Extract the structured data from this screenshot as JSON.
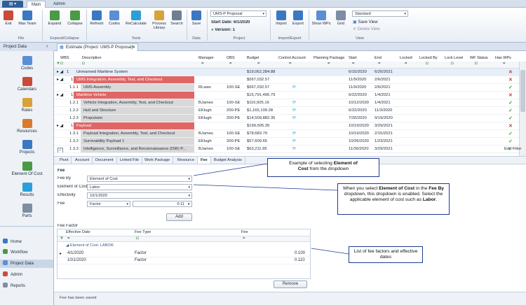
{
  "app_menu_label": "▤ ▾",
  "tabs": [
    {
      "label": "Main"
    },
    {
      "label": "Admin"
    }
  ],
  "ribbon": {
    "exit": "Exit",
    "max_team": "Max Team",
    "expand": "Expand",
    "collapse": "Collapse",
    "refresh": "Refresh",
    "codes": "Codes",
    "recalculate": "ReCalculate",
    "process_library_1": "Process",
    "process_library_2": "Library",
    "search": "Search",
    "save": "Save",
    "project_name": "UMS-P Proposal",
    "start_date_label": "Start Date:",
    "start_date_value": "6/1/2020",
    "version_label": "Version:",
    "version_value": "1",
    "import": "Import",
    "export": "Export",
    "show_wps": "Show WPs",
    "grid": "Grid",
    "view_name": "Standard",
    "save_view": "Save View",
    "delete_view": "Delete View",
    "groups": {
      "file": "File",
      "expand_collapse": "Expand/Collapse",
      "tools": "Tools",
      "data": "Data",
      "project": "Project",
      "import_export": "Import/Export",
      "view": "View"
    }
  },
  "left_panel": {
    "title": "Project Data",
    "items": [
      {
        "label": "Codes"
      },
      {
        "label": "Calendars"
      },
      {
        "label": "Rates"
      },
      {
        "label": "Resources"
      },
      {
        "label": "Projects"
      },
      {
        "label": "Element Of Cost"
      },
      {
        "label": "Results"
      },
      {
        "label": "Parts"
      }
    ],
    "bottom": [
      {
        "label": "Home"
      },
      {
        "label": "Workflow"
      },
      {
        "label": "Project Data"
      },
      {
        "label": "Admin"
      },
      {
        "label": "Reports"
      }
    ]
  },
  "doc_tab": "Estimate (Project: UMS-P Proposal)",
  "grid": {
    "headers": [
      "WBS",
      "Description",
      "Manager",
      "OBS",
      "Budget",
      "Control Account",
      "Planning Package",
      "Start",
      "End",
      "Locked",
      "Locked By",
      "Lock Level",
      "WF Status",
      "Has WPs"
    ],
    "rows": [
      {
        "wbs": "1",
        "desc": "Unmanned Maritime System",
        "mgr": "",
        "obs": "",
        "budget": "$19,062,284.88",
        "ca": "",
        "start": "6/15/2020",
        "end": "6/20/2021",
        "haswp": "✕",
        "style": "top"
      },
      {
        "wbs": "1.1",
        "desc": "UMS Integration, Assembly, Test, and Checkout",
        "mgr": "",
        "obs": "",
        "budget": "$567,032.57",
        "ca": "",
        "start": "11/9/2020",
        "end": "2/6/2021",
        "haswp": "✕",
        "style": "red"
      },
      {
        "wbs": "1.1.1",
        "desc": "UMS Assembly",
        "mgr": "RLaws",
        "obs": "100-SE",
        "budget": "$567,032.57",
        "ca": "⟳",
        "start": "11/9/2020",
        "end": "2/6/2021",
        "haswp": "✓",
        "style": "grey"
      },
      {
        "wbs": "1.2",
        "desc": "Maritime Vehicle",
        "mgr": "",
        "obs": "",
        "budget": "$15,791,496.79",
        "ca": "",
        "start": "6/22/2020",
        "end": "1/4/2021",
        "haswp": "✕",
        "style": "red"
      },
      {
        "wbs": "1.2.1",
        "desc": "Vehicle Integration, Assembly, Test, and Checkout",
        "mgr": "BJames",
        "obs": "100-SE",
        "budget": "$116,505.16",
        "ca": "⟳",
        "start": "10/12/2020",
        "end": "1/4/2021",
        "haswp": "✓",
        "style": "grey"
      },
      {
        "wbs": "1.2.2",
        "desc": "Hull and Structure",
        "mgr": "EKlugh",
        "obs": "200-PE",
        "budget": "$1,165,109.28",
        "ca": "⟳",
        "start": "6/22/2020",
        "end": "11/3/2020",
        "haswp": "✓",
        "style": "grey"
      },
      {
        "wbs": "1.2.3",
        "desc": "Propulsion",
        "mgr": "EKlugh",
        "obs": "200-PE",
        "budget": "$14,509,882.35",
        "ca": "⟳",
        "start": "7/20/2020",
        "end": "9/19/2020",
        "haswp": "✓",
        "style": "grey"
      },
      {
        "wbs": "1.3",
        "desc": "Payload",
        "mgr": "",
        "obs": "",
        "budget": "$199,505.39",
        "ca": "",
        "start": "10/19/2020",
        "end": "3/29/2021",
        "haswp": "✕",
        "style": "red"
      },
      {
        "wbs": "1.3.1",
        "desc": "Payload Integration, Assembly, Test, and Checkout",
        "mgr": "BJames",
        "obs": "100-SE",
        "budget": "$78,683.79",
        "ca": "⟳",
        "start": "10/19/2020",
        "end": "2/15/2021",
        "haswp": "✓",
        "style": "grey"
      },
      {
        "wbs": "1.3.2",
        "desc": "Survivability Payload 1",
        "mgr": "EKlugh",
        "obs": "200-PE",
        "budget": "$57,609.65",
        "ca": "⟳",
        "start": "10/26/2020",
        "end": "1/23/2021",
        "haswp": "✓",
        "style": "grey"
      },
      {
        "wbs": "1.3.3",
        "desc": "Intelligence, Surveillance, and Reconnaissance (ISR) P...",
        "mgr": "BJames",
        "obs": "100-SE",
        "budget": "$63,211.95",
        "ca": "⟳",
        "start": "11/30/2020",
        "end": "3/29/2021",
        "haswp": "✓",
        "style": "grey"
      }
    ],
    "edit_filter": "Edit Filter"
  },
  "sub_tabs": [
    "Pivot",
    "Account",
    "Document",
    "Linked File",
    "Work Package",
    "Resource",
    "Fee",
    "Budget Analysis"
  ],
  "fee": {
    "section": "Fee",
    "fee_by_label": "Fee By",
    "fee_by_value": "Element of Cost",
    "eoc_label": "Element of Cost",
    "eoc_value": "Labor",
    "effectivity_label": "Effectivity",
    "effectivity_value": "10/1/2020",
    "fee_label": "Fee",
    "fee_type_value": "Factor",
    "fee_value": "0.11",
    "add_button": "Add"
  },
  "fee_factor": {
    "section": "Fee Factor",
    "headers": [
      "Effective Date",
      "Fee Type",
      "Fee"
    ],
    "group": "Element of Cost: LABOR",
    "rows": [
      {
        "date": "4/1/2020",
        "type": "Factor",
        "fee": "0.100"
      },
      {
        "date": "10/1/2020",
        "type": "Factor",
        "fee": "0.110"
      }
    ],
    "remove_button": "Remove"
  },
  "callouts": {
    "c1_a": "Example of selecting",
    "c1_b": "Element of",
    "c1_c": "Cost",
    "c1_d": "from the dropdown",
    "c2_a": "When you select",
    "c2_b": "Element of Cost",
    "c2_c": "in the",
    "c2_d": "Fee By",
    "c2_e": "dropdown, this dropdown is enabled. Select the applicable element of cost such as",
    "c2_f": "Labor",
    "c3": "List of fee factors and effective dates"
  },
  "status": "Fee has been saved",
  "colors": {
    "accent": "#2e5f9a",
    "red_row": "#e06666",
    "grey_row": "#d9d9d9",
    "callout_border": "#1f3a93"
  }
}
